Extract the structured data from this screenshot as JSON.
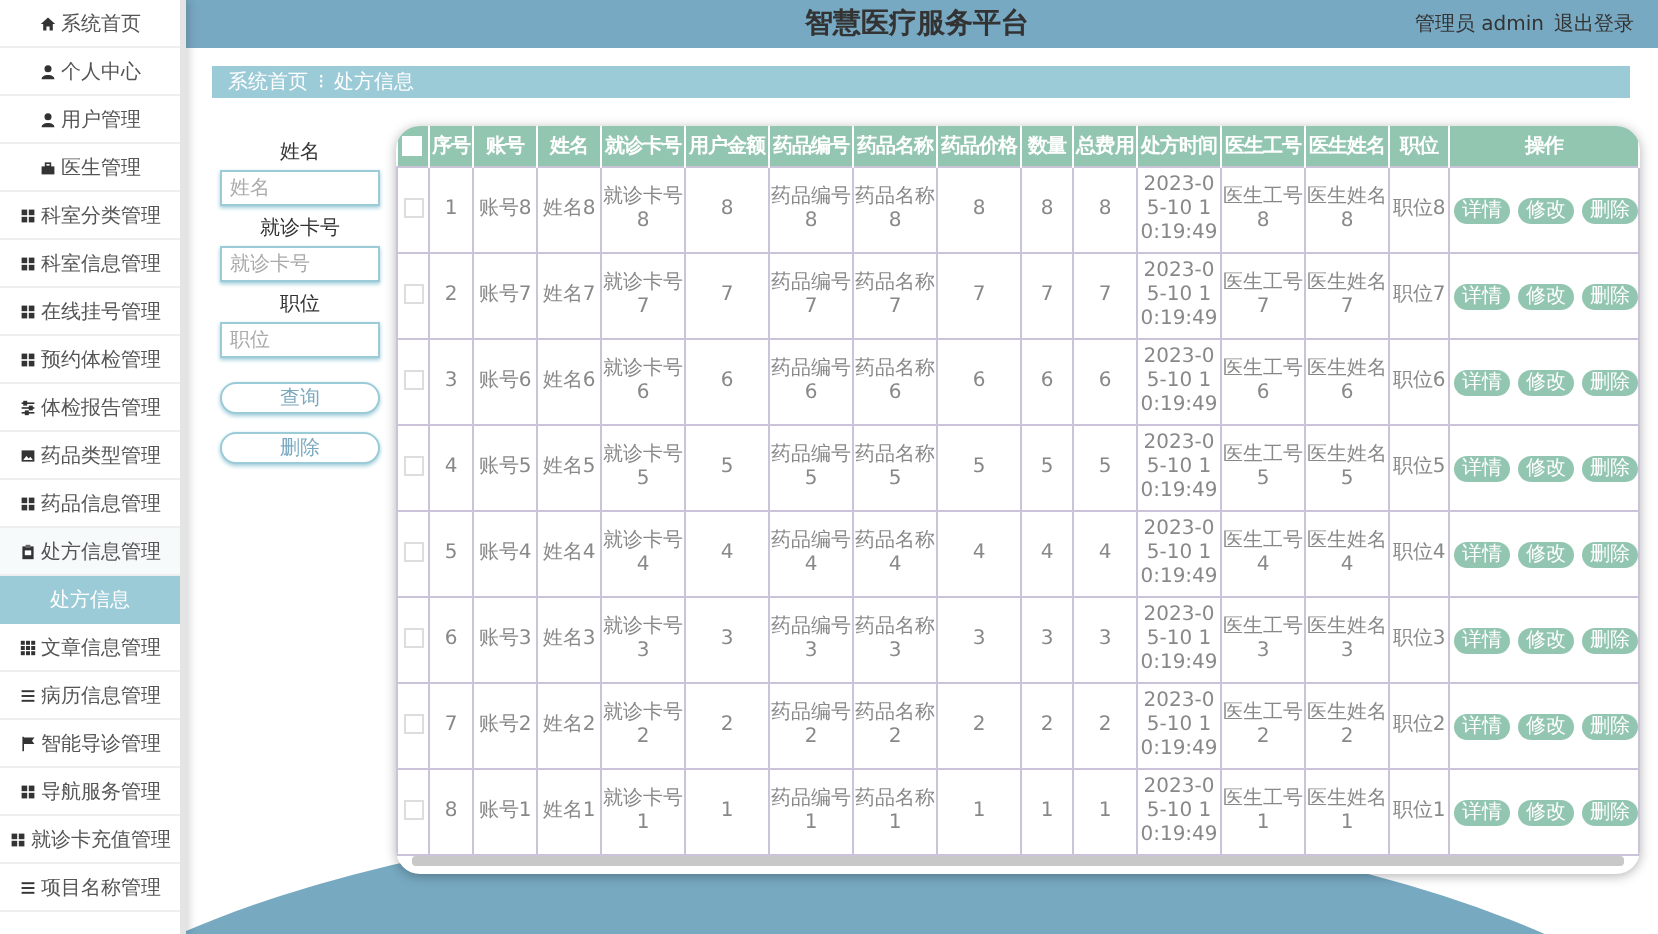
{
  "sidebar": {
    "items": [
      {
        "label": "系统首页",
        "kind": "home",
        "selected": false
      },
      {
        "label": "个人中心",
        "kind": "user",
        "selected": false
      },
      {
        "label": "用户管理",
        "kind": "user",
        "selected": false
      },
      {
        "label": "医生管理",
        "kind": "case",
        "selected": false
      },
      {
        "label": "科室分类管理",
        "kind": "grid",
        "selected": false
      },
      {
        "label": "科室信息管理",
        "kind": "grid",
        "selected": false
      },
      {
        "label": "在线挂号管理",
        "kind": "grid",
        "selected": false
      },
      {
        "label": "预约体检管理",
        "kind": "grid",
        "selected": false
      },
      {
        "label": "体检报告管理",
        "kind": "sliders",
        "selected": false
      },
      {
        "label": "药品类型管理",
        "kind": "picture",
        "selected": false
      },
      {
        "label": "药品信息管理",
        "kind": "grid",
        "selected": false
      },
      {
        "label": "处方信息管理",
        "kind": "clipboard",
        "selected": false,
        "expanded": true,
        "children": [
          {
            "label": "处方信息",
            "selected": true
          }
        ]
      },
      {
        "label": "文章信息管理",
        "kind": "grid9",
        "selected": false
      },
      {
        "label": "病历信息管理",
        "kind": "list",
        "selected": false
      },
      {
        "label": "智能导诊管理",
        "kind": "flag",
        "selected": false
      },
      {
        "label": "导航服务管理",
        "kind": "grid",
        "selected": false
      },
      {
        "label": "就诊卡充值管理",
        "kind": "grid",
        "selected": false
      },
      {
        "label": "项目名称管理",
        "kind": "list",
        "selected": false
      }
    ]
  },
  "header": {
    "title": "智慧医疗服务平台",
    "user": "管理员 admin",
    "logout": "退出登录"
  },
  "breadcrumb": {
    "home": "系统首页",
    "separator": "⁝",
    "current": "处方信息"
  },
  "search": {
    "fields": [
      {
        "label": "姓名",
        "placeholder": "姓名"
      },
      {
        "label": "就诊卡号",
        "placeholder": "就诊卡号"
      },
      {
        "label": "职位",
        "placeholder": "职位"
      }
    ],
    "buttons": [
      "查询",
      "删除"
    ]
  },
  "table": {
    "header_checked": false,
    "columns": [
      "序号",
      "账号",
      "姓名",
      "就诊卡号",
      "用户金额",
      "药品编号",
      "药品名称",
      "药品价格",
      "数量",
      "总费用",
      "处方时间",
      "医生工号",
      "医生姓名",
      "职位",
      "操作"
    ],
    "rows": [
      {
        "checked": false,
        "cells": [
          "1",
          "账号8",
          "姓名8",
          "就诊卡号8",
          "8",
          "药品编号8",
          "药品名称8",
          "8",
          "8",
          "8",
          "2023-05-10 10:19:49",
          "医生工号8",
          "医生姓名8",
          "职位8"
        ],
        "actions": [
          "详情",
          "修改",
          "删除"
        ]
      },
      {
        "checked": false,
        "cells": [
          "2",
          "账号7",
          "姓名7",
          "就诊卡号7",
          "7",
          "药品编号7",
          "药品名称7",
          "7",
          "7",
          "7",
          "2023-05-10 10:19:49",
          "医生工号7",
          "医生姓名7",
          "职位7"
        ],
        "actions": [
          "详情",
          "修改",
          "删除"
        ]
      },
      {
        "checked": false,
        "cells": [
          "3",
          "账号6",
          "姓名6",
          "就诊卡号6",
          "6",
          "药品编号6",
          "药品名称6",
          "6",
          "6",
          "6",
          "2023-05-10 10:19:49",
          "医生工号6",
          "医生姓名6",
          "职位6"
        ],
        "actions": [
          "详情",
          "修改",
          "删除"
        ]
      },
      {
        "checked": false,
        "cells": [
          "4",
          "账号5",
          "姓名5",
          "就诊卡号5",
          "5",
          "药品编号5",
          "药品名称5",
          "5",
          "5",
          "5",
          "2023-05-10 10:19:49",
          "医生工号5",
          "医生姓名5",
          "职位5"
        ],
        "actions": [
          "详情",
          "修改",
          "删除"
        ]
      },
      {
        "checked": false,
        "cells": [
          "5",
          "账号4",
          "姓名4",
          "就诊卡号4",
          "4",
          "药品编号4",
          "药品名称4",
          "4",
          "4",
          "4",
          "2023-05-10 10:19:49",
          "医生工号4",
          "医生姓名4",
          "职位4"
        ],
        "actions": [
          "详情",
          "修改",
          "删除"
        ]
      },
      {
        "checked": false,
        "cells": [
          "6",
          "账号3",
          "姓名3",
          "就诊卡号3",
          "3",
          "药品编号3",
          "药品名称3",
          "3",
          "3",
          "3",
          "2023-05-10 10:19:49",
          "医生工号3",
          "医生姓名3",
          "职位3"
        ],
        "actions": [
          "详情",
          "修改",
          "删除"
        ]
      },
      {
        "checked": false,
        "cells": [
          "7",
          "账号2",
          "姓名2",
          "就诊卡号2",
          "2",
          "药品编号2",
          "药品名称2",
          "2",
          "2",
          "2",
          "2023-05-10 10:19:49",
          "医生工号2",
          "医生姓名2",
          "职位2"
        ],
        "actions": [
          "详情",
          "修改",
          "删除"
        ]
      },
      {
        "checked": false,
        "cells": [
          "8",
          "账号1",
          "姓名1",
          "就诊卡号1",
          "1",
          "药品编号1",
          "药品名称1",
          "1",
          "1",
          "1",
          "2023-05-10 10:19:49",
          "医生工号1",
          "医生姓名1",
          "职位1"
        ],
        "actions": [
          "详情",
          "修改",
          "删除"
        ]
      }
    ]
  }
}
